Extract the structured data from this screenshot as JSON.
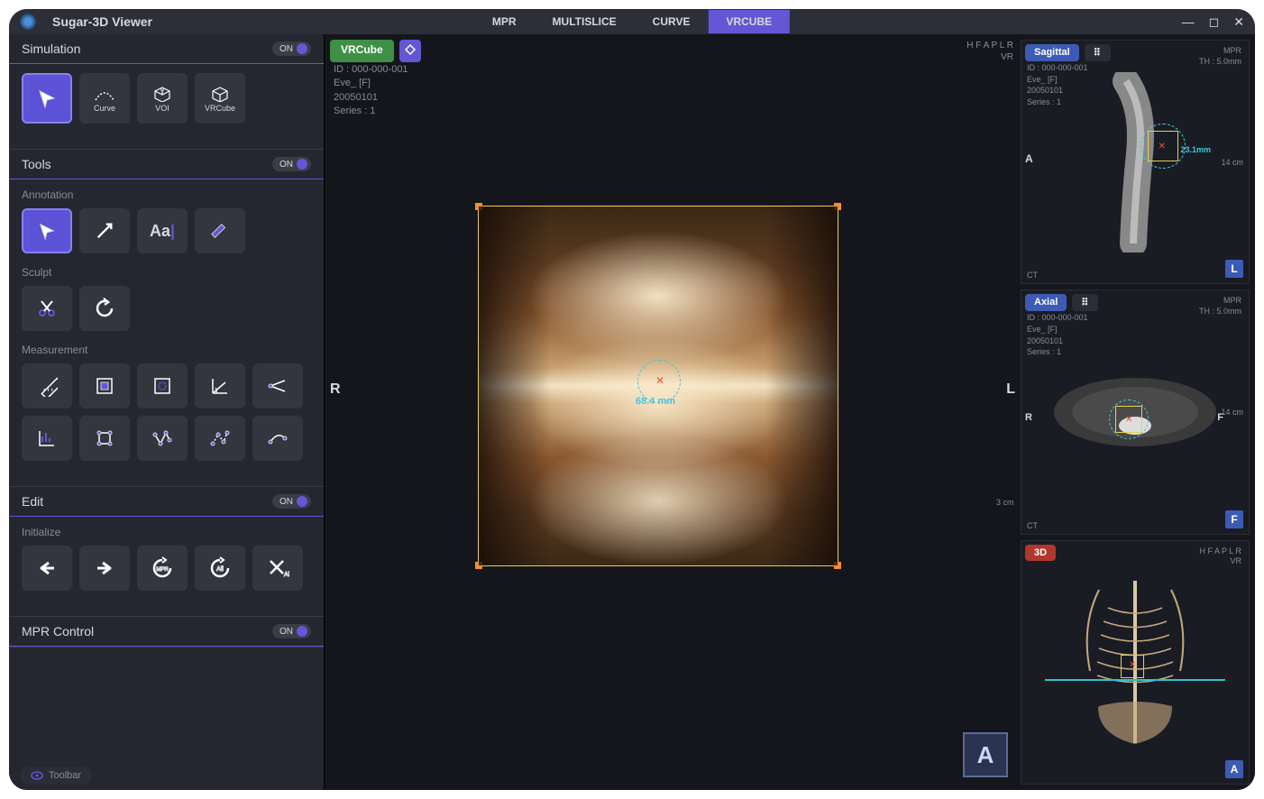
{
  "app": {
    "title": "Sugar-3D Viewer"
  },
  "tabs": {
    "mpr": "MPR",
    "multislice": "MULTISLICE",
    "curve": "CURVE",
    "vrcube": "VRCUBE"
  },
  "sidebar": {
    "simulation": {
      "title": "Simulation",
      "toggle": "ON",
      "items": {
        "select": "",
        "curve": "Curve",
        "voi": "VOI",
        "vrcube": "VRCube"
      }
    },
    "tools": {
      "title": "Tools",
      "toggle": "ON",
      "annotation_label": "Annotation",
      "sculpt_label": "Sculpt",
      "measurement_label": "Measurement"
    },
    "edit": {
      "title": "Edit",
      "toggle": "ON",
      "initialize_label": "Initialize"
    },
    "mpr": {
      "title": "MPR Control",
      "toggle": "ON"
    }
  },
  "toolbar_chip": "Toolbar",
  "viewport": {
    "main": {
      "badge": "VRCube",
      "info": {
        "id": "ID : 000-000-001",
        "name": "Eve_ [F]",
        "date": "20050101",
        "series": "Series : 1"
      },
      "tr": {
        "line1": "H F A P L R",
        "line2": "VR"
      },
      "left_orient": "R",
      "right_orient": "L",
      "measure": "68.4 mm",
      "cube_face": "A"
    },
    "sagittal": {
      "badge": "Sagittal",
      "info": {
        "id": "ID : 000-000-001",
        "name": "Eve_ [F]",
        "date": "20050101",
        "series": "Series : 1"
      },
      "tr": {
        "line1": "MPR",
        "line2": "TH : 5.0mm"
      },
      "orient_a": "A",
      "ct": "CT",
      "measure": "23.1mm",
      "scale": "14 cm",
      "corner": "L"
    },
    "axial": {
      "badge": "Axial",
      "info": {
        "id": "ID : 000-000-001",
        "name": "Eve_ [F]",
        "date": "20050101",
        "series": "Series : 1"
      },
      "tr": {
        "line1": "MPR",
        "line2": "TH : 5.0mm"
      },
      "orient_r": "R",
      "orient_f": "F",
      "ct": "CT",
      "scale_l": "3 cm",
      "scale_r": "14 cm",
      "corner": "F"
    },
    "d3": {
      "badge": "3D",
      "tr": {
        "line1": "H F A P L R",
        "line2": "VR"
      },
      "corner": "A"
    }
  }
}
